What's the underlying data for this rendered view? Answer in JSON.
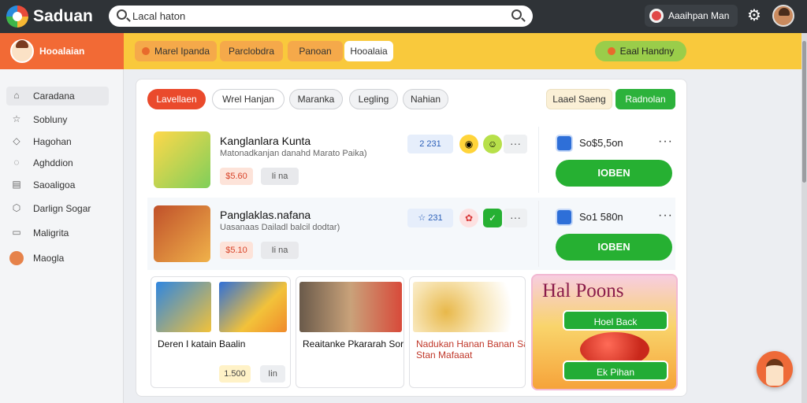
{
  "app": {
    "title": "Saduan"
  },
  "search": {
    "placeholder": "Lacal haton",
    "value": "Lacal haton"
  },
  "header_user": {
    "name": "Aaaihpan Man"
  },
  "sidebar": {
    "profile_label": "Hooalaian",
    "items": [
      {
        "label": "Caradana",
        "icon": "home-icon"
      },
      {
        "label": "Sobluny",
        "icon": "star-icon"
      },
      {
        "label": "Hagohan",
        "icon": "tag-icon"
      },
      {
        "label": "Aghddion",
        "icon": "chat-icon"
      },
      {
        "label": "Saoaligoa",
        "icon": "document-icon"
      },
      {
        "label": "Darlign Sogar",
        "icon": "box-icon"
      },
      {
        "label": "Maligrita",
        "icon": "message-icon"
      },
      {
        "label": "Maogla",
        "icon": "avatar-icon"
      }
    ]
  },
  "banner": {
    "chips": [
      "Marel Ipanda",
      "Parclobdra",
      "Panoan",
      "Hooalaia"
    ],
    "right_chip": "Eaal Handny"
  },
  "filters": {
    "left": [
      "Lavellaen",
      "Wrel Hanjan",
      "Maranka",
      "Legling",
      "Nahian"
    ],
    "right": [
      "Laael Saeng",
      "Radnolan"
    ]
  },
  "rows": [
    {
      "title": "Kanglanlara Kunta",
      "subtitle": "Matonadkanjan danahd Marato Paika)",
      "price": "$5.60",
      "qty": "Ii na",
      "stat": "2 231",
      "currency_value": "So$5,5on",
      "cta": "IOBEN"
    },
    {
      "title": "Panglaklas.nafana",
      "subtitle": "Uasanaas Dailadl balcil dodtar)",
      "price": "$5.10",
      "qty": "Ii na",
      "stat": "☆ 231",
      "currency_value": "So1 580n",
      "cta": "IOBEN"
    }
  ],
  "tiles": [
    {
      "title": "Deren I katain Baalin",
      "price": "1.500",
      "qty": "Iin"
    },
    {
      "title": "Reaitanke Pkararah Sortg"
    },
    {
      "title": "Nadukan Hanan Banan Saral Stan Mafaaat"
    }
  ],
  "promo": {
    "title": "Hal Poons",
    "buttons": [
      "Hoel Back",
      "Ek Pihan"
    ]
  },
  "colors": {
    "accent_orange": "#f26a35",
    "banner_yellow": "#f9c93c",
    "cta_green": "#26b032",
    "filter_red": "#ea4a2c"
  }
}
